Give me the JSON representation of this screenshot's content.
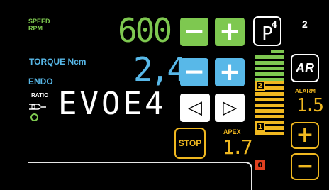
{
  "labels": {
    "speed": "SPEED",
    "rpm": "RPM",
    "torque": "TORQUE Ncm",
    "endo": "ENDO",
    "ratio": "RATIO",
    "alarm": "ALARM",
    "apex": "APEX"
  },
  "values": {
    "speed": "600",
    "torque": "2,4",
    "ratio_text": "EVOE4",
    "alarm": "1.5",
    "apex": "1.7",
    "program_number": "2"
  },
  "buttons": {
    "speed_minus": "−",
    "speed_plus": "+",
    "torque_minus": "−",
    "torque_plus": "+",
    "left": "◁",
    "right": "▷",
    "stop": "STOP",
    "program": "P",
    "program_sup": "4",
    "ar": "AR",
    "alarm_plus": "+",
    "alarm_minus": "−"
  },
  "bar_scale": {
    "markers": [
      "2",
      "1",
      "0"
    ]
  },
  "colors": {
    "green": "#7ec850",
    "blue": "#58b8e8",
    "yellow": "#f0b820",
    "red": "#e04020",
    "white": "#ffffff"
  }
}
